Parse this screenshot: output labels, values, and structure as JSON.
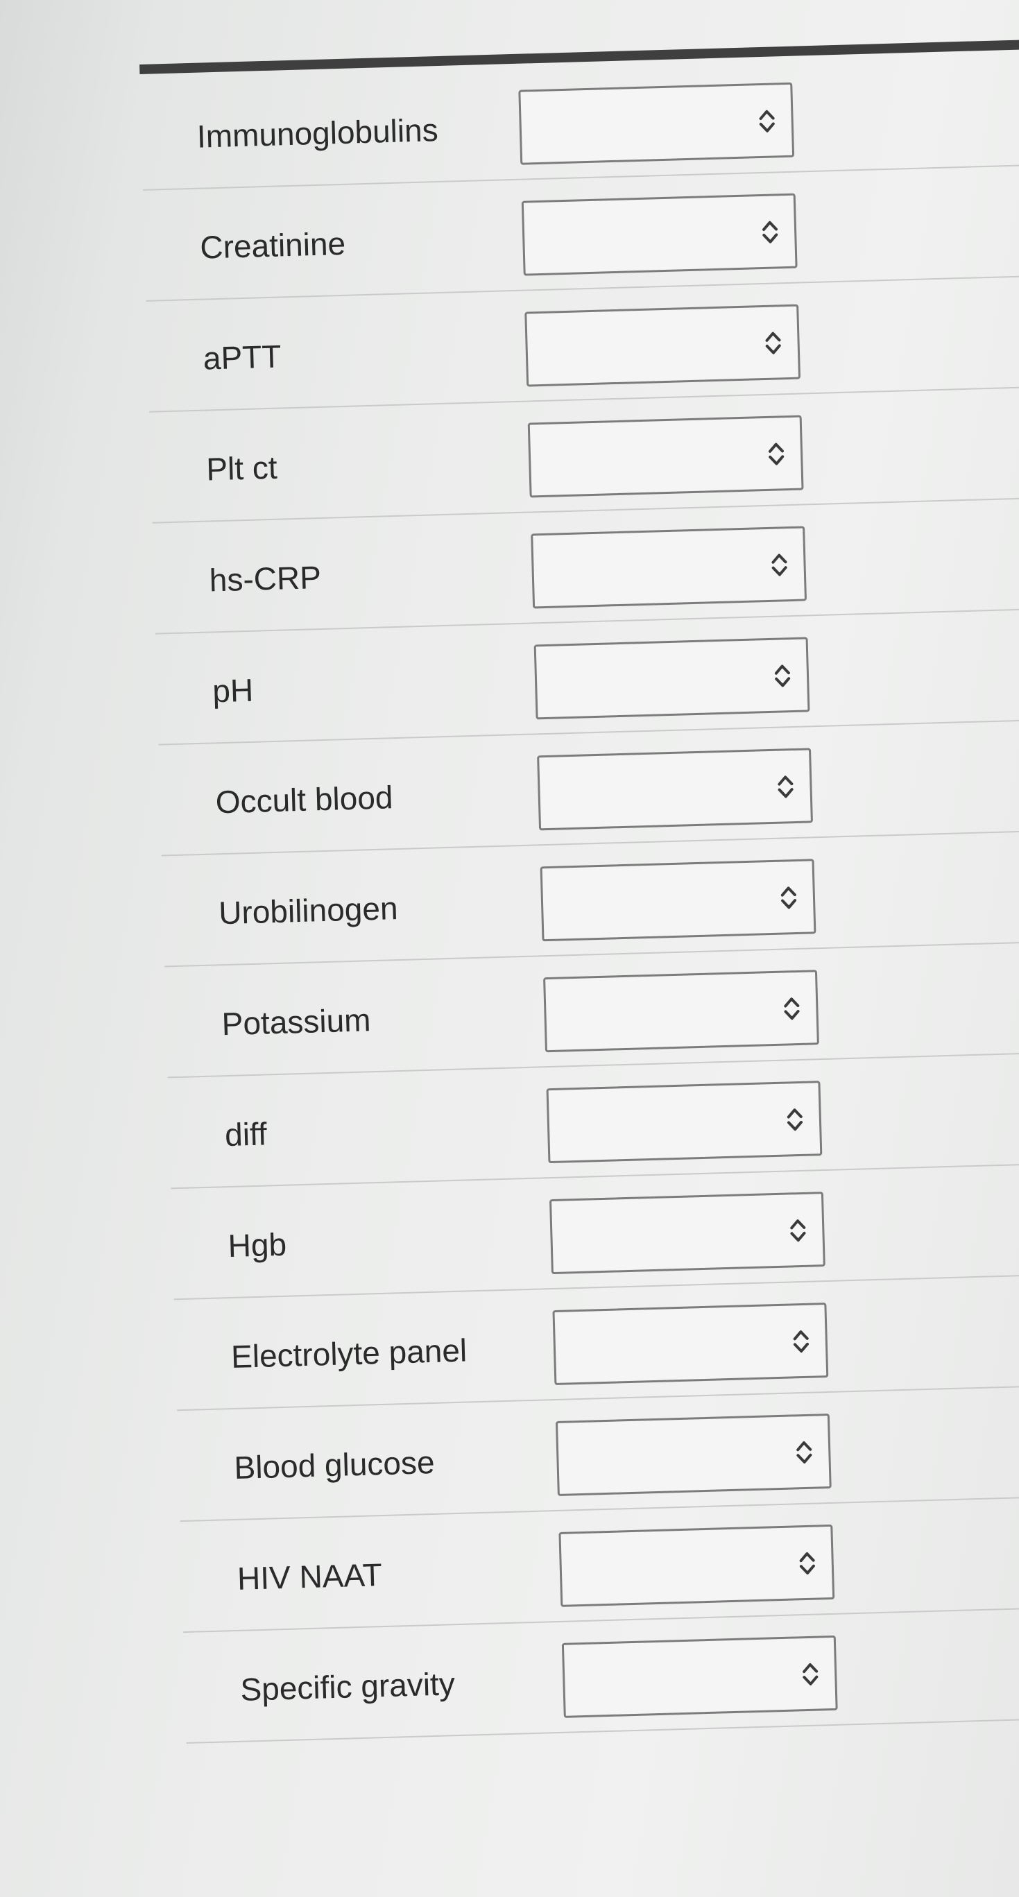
{
  "form": {
    "rows": [
      {
        "label": "Immunoglobulins",
        "value": ""
      },
      {
        "label": "Creatinine",
        "value": ""
      },
      {
        "label": "aPTT",
        "value": ""
      },
      {
        "label": "Plt ct",
        "value": ""
      },
      {
        "label": "hs-CRP",
        "value": ""
      },
      {
        "label": "pH",
        "value": ""
      },
      {
        "label": "Occult blood",
        "value": ""
      },
      {
        "label": "Urobilinogen",
        "value": ""
      },
      {
        "label": "Potassium",
        "value": ""
      },
      {
        "label": "diff",
        "value": ""
      },
      {
        "label": "Hgb",
        "value": ""
      },
      {
        "label": "Electrolyte panel",
        "value": ""
      },
      {
        "label": "Blood glucose",
        "value": ""
      },
      {
        "label": "HIV NAAT",
        "value": ""
      },
      {
        "label": "Specific gravity",
        "value": ""
      }
    ],
    "select_icon": "chevron-up-down-icon"
  },
  "colors": {
    "text": "#2a2a2a",
    "box_border": "#7c7c7c",
    "top_rule": "#3f3f3f",
    "divider": "#c9cac9"
  }
}
